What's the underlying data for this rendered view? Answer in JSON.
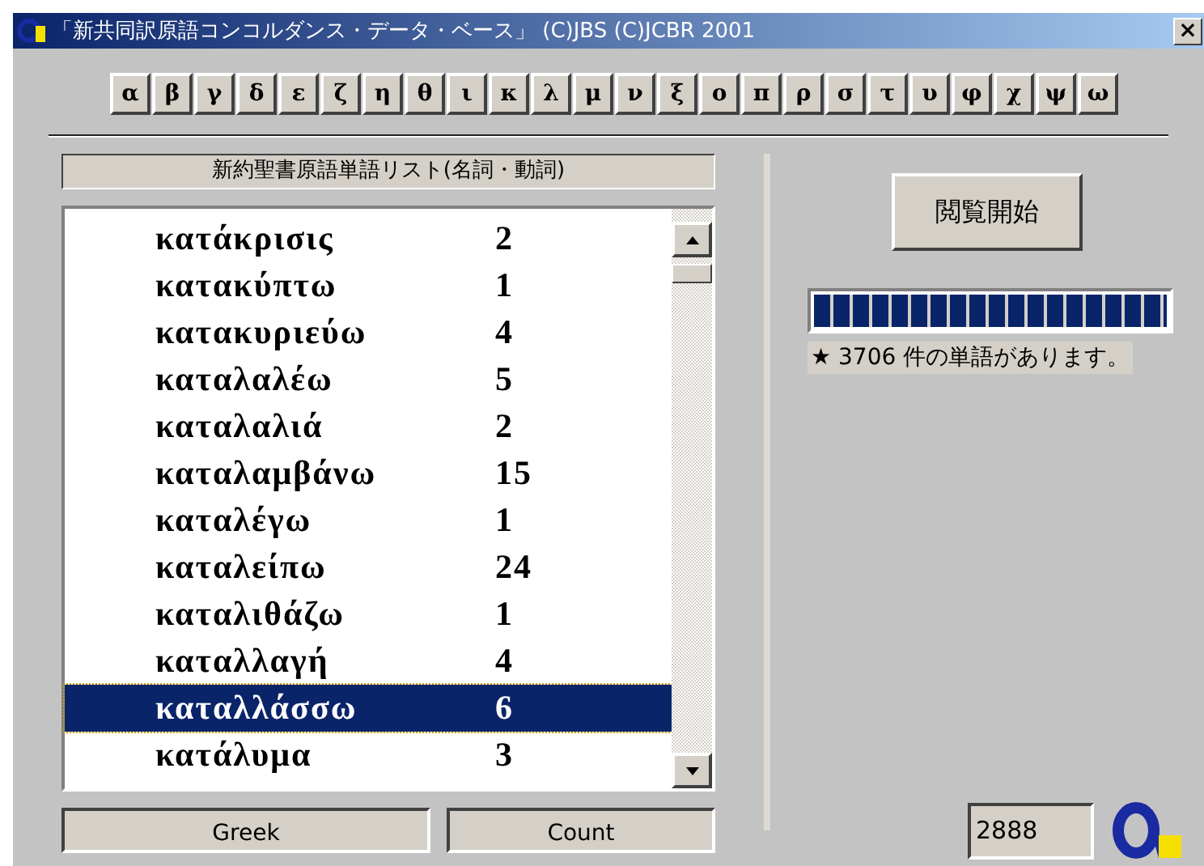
{
  "window": {
    "title": "「新共同訳原語コンコルダンス・データ・ベース」 (C)JBS  (C)JCBR  2001",
    "close": "×"
  },
  "letters": [
    "α",
    "β",
    "γ",
    "δ",
    "ε",
    "ζ",
    "η",
    "θ",
    "ι",
    "κ",
    "λ",
    "μ",
    "ν",
    "ξ",
    "ο",
    "π",
    "ρ",
    "σ",
    "τ",
    "υ",
    "φ",
    "χ",
    "ψ",
    "ω"
  ],
  "list": {
    "header": "新約聖書原語単語リスト(名詞・動詞)",
    "rows": [
      {
        "word": "κατάκρισις",
        "count": "2",
        "selected": false
      },
      {
        "word": "κατακύπτω",
        "count": "1",
        "selected": false
      },
      {
        "word": "κατακυριεύω",
        "count": "4",
        "selected": false
      },
      {
        "word": "καταλαλέω",
        "count": "5",
        "selected": false
      },
      {
        "word": "καταλαλιά",
        "count": "2",
        "selected": false
      },
      {
        "word": "καταλαμβάνω",
        "count": "15",
        "selected": false
      },
      {
        "word": "καταλέγω",
        "count": "1",
        "selected": false
      },
      {
        "word": "καταλείπω",
        "count": "24",
        "selected": false
      },
      {
        "word": "καταλιθάζω",
        "count": "1",
        "selected": false
      },
      {
        "word": "καταλλαγή",
        "count": "4",
        "selected": false
      },
      {
        "word": "καταλλάσσω",
        "count": "6",
        "selected": true
      },
      {
        "word": "κατάλυμα",
        "count": "3",
        "selected": false
      }
    ],
    "columns": [
      "Greek",
      "Count"
    ]
  },
  "browse_button": "閲覧開始",
  "progress": {
    "level": 1
  },
  "status": "★ 3706  件の単語があります。",
  "count_field": "2888"
}
